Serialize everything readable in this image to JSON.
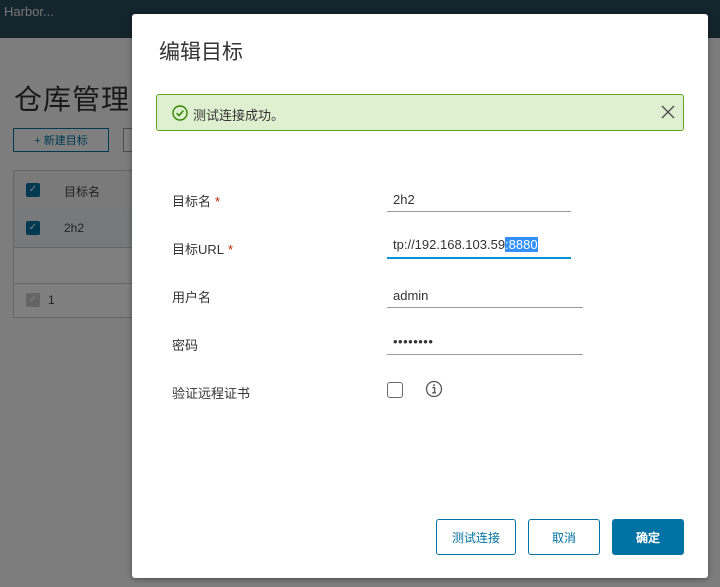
{
  "background": {
    "app_title": "Harbor...",
    "page_title": "仓库管理",
    "new_target_button": "+ 新建目标",
    "table": {
      "header": "目标名",
      "row_name": "2h2",
      "footer_count": "1"
    }
  },
  "modal": {
    "title": "编辑目标",
    "alert": {
      "message": "测试连接成功。"
    },
    "fields": {
      "name_label": "目标名",
      "name_value": "2h2",
      "url_label": "目标URL",
      "url_value_unselected": "tp://192.168.103.59",
      "url_value_selected": ":8880",
      "username_label": "用户名",
      "username_value": "admin",
      "password_label": "密码",
      "password_value": "••••••••",
      "verify_cert_label": "验证远程证书"
    },
    "required_marker": "*",
    "buttons": {
      "test": "测试连接",
      "cancel": "取消",
      "ok": "确定"
    }
  },
  "colors": {
    "accent": "#0072a3",
    "success_border": "#62a420",
    "success_bg": "#dff0d0",
    "required": "#c92100",
    "selection": "#3390ff"
  }
}
